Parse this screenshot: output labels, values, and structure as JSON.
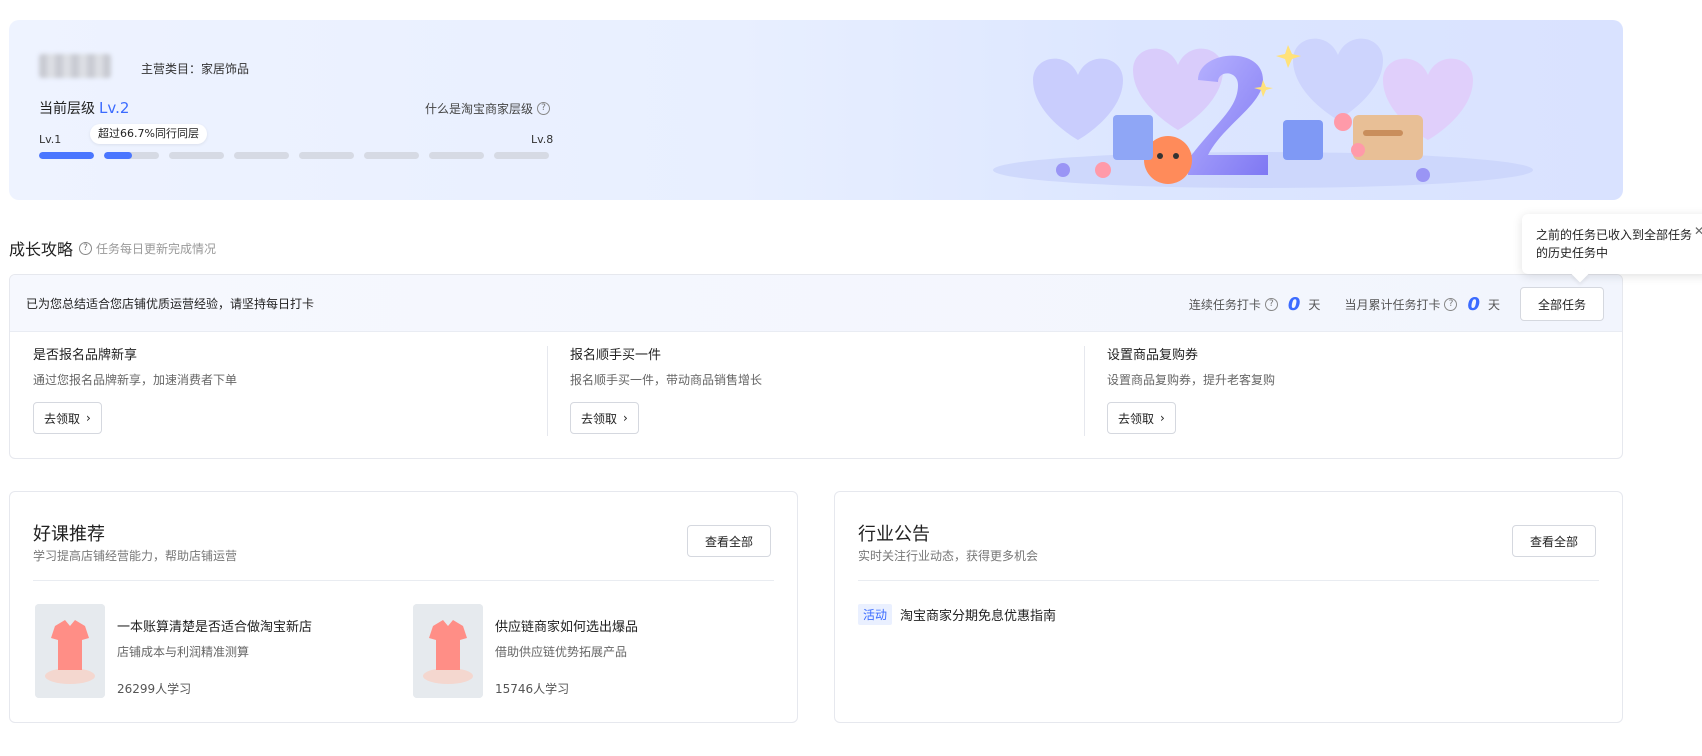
{
  "banner": {
    "category": "主营类目：家居饰品",
    "current_level_label": "当前层级",
    "current_level_value": "Lv.2",
    "what_is_level": "什么是淘宝商家层级",
    "level_min": "Lv.1",
    "level_max": "Lv.8",
    "percentile_tip": "超过66.7%同行同层",
    "segment_fill": [
      1,
      0.5,
      0,
      0,
      0,
      0,
      0,
      0
    ]
  },
  "growth": {
    "title": "成长攻略",
    "help": "任务每日更新完成情况",
    "popover": "之前的任务已收入到全部任务的历史任务中",
    "intro": "已为您总结适合您店铺优质运营经验，请坚持每日打卡",
    "streak_label": "连续任务打卡",
    "streak_count": "0",
    "monthly_label": "当月累计任务打卡",
    "monthly_count": "0",
    "day_unit": "天",
    "all_tasks": "全部任务",
    "tasks": [
      {
        "title": "是否报名品牌新享",
        "desc": "通过您报名品牌新享，加速消费者下单",
        "button": "去领取"
      },
      {
        "title": "报名顺手买一件",
        "desc": "报名顺手买一件，带动商品销售增长",
        "button": "去领取"
      },
      {
        "title": "设置商品复购券",
        "desc": "设置商品复购券，提升老客复购",
        "button": "去领取"
      }
    ]
  },
  "courses": {
    "title": "好课推荐",
    "subtitle": "学习提高店铺经营能力，帮助店铺运营",
    "view_all": "查看全部",
    "items": [
      {
        "title": "一本账算清楚是否适合做淘宝新店",
        "desc": "店铺成本与利润精准测算",
        "count": "26299人学习"
      },
      {
        "title": "供应链商家如何选出爆品",
        "desc": "借助供应链优势拓展产品",
        "count": "15746人学习"
      }
    ]
  },
  "announcements": {
    "title": "行业公告",
    "subtitle": "实时关注行业动态，获得更多机会",
    "view_all": "查看全部",
    "items": [
      {
        "tag": "活动",
        "text": "淘宝商家分期免息优惠指南"
      }
    ]
  },
  "colors": {
    "accent": "#3b6bff",
    "progress": "#4a76ff"
  }
}
